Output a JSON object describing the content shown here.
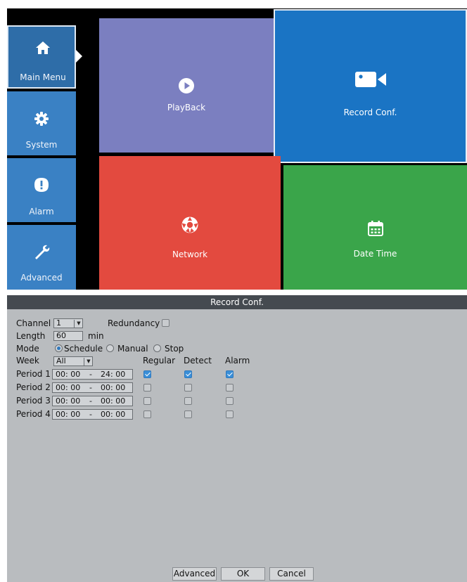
{
  "menu": {
    "sidebar": [
      {
        "label": "Main Menu",
        "icon": "home-icon"
      },
      {
        "label": "System",
        "icon": "gear-icon"
      },
      {
        "label": "Alarm",
        "icon": "alert-icon"
      },
      {
        "label": "Advanced",
        "icon": "wrench-icon"
      }
    ],
    "tiles": {
      "playback": {
        "label": "PlayBack",
        "icon": "play-icon",
        "color": "#7b7fc0"
      },
      "record": {
        "label": "Record Conf.",
        "icon": "video-camera-icon",
        "color": "#1a74c4"
      },
      "network": {
        "label": "Network",
        "icon": "network-globe-icon",
        "color": "#e34a3f"
      },
      "datetime": {
        "label": "Date Time",
        "icon": "calendar-icon",
        "color": "#3aa54a"
      }
    }
  },
  "dialog": {
    "title": "Record Conf.",
    "channel_label": "Channel",
    "channel_value": "1",
    "redundancy_label": "Redundancy",
    "redundancy_checked": false,
    "length_label": "Length",
    "length_value": "60",
    "length_unit": "min",
    "mode_label": "Mode",
    "modes": [
      {
        "label": "Schedule",
        "selected": true
      },
      {
        "label": "Manual",
        "selected": false
      },
      {
        "label": "Stop",
        "selected": false
      }
    ],
    "week_label": "Week",
    "week_value": "All",
    "columns": [
      "Regular",
      "Detect",
      "Alarm"
    ],
    "periods": [
      {
        "label": "Period 1",
        "start": "00: 00",
        "sep": "-",
        "end": "24: 00",
        "regular": true,
        "detect": true,
        "alarm": true
      },
      {
        "label": "Period 2",
        "start": "00: 00",
        "sep": "-",
        "end": "00: 00",
        "regular": false,
        "detect": false,
        "alarm": false
      },
      {
        "label": "Period 3",
        "start": "00: 00",
        "sep": "-",
        "end": "00: 00",
        "regular": false,
        "detect": false,
        "alarm": false
      },
      {
        "label": "Period 4",
        "start": "00: 00",
        "sep": "-",
        "end": "00: 00",
        "regular": false,
        "detect": false,
        "alarm": false
      }
    ],
    "buttons": {
      "advanced": "Advanced",
      "ok": "OK",
      "cancel": "Cancel"
    }
  },
  "colors": {
    "accent": "#3a81c4",
    "title_bar": "#454a50",
    "dialog_bg": "#b9bcbf"
  }
}
